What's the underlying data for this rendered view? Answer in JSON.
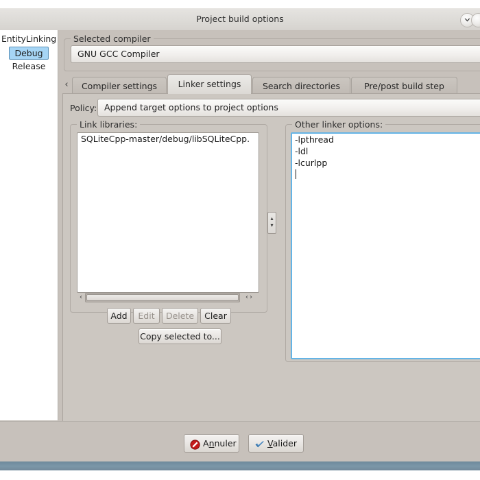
{
  "window": {
    "title": "Project build options",
    "collapse_icon": "chevron-down-icon"
  },
  "sidebar": {
    "items": [
      {
        "label": "EntityLinking",
        "selected": false,
        "level": 0
      },
      {
        "label": "Debug",
        "selected": true,
        "level": 1
      },
      {
        "label": "Release",
        "selected": false,
        "level": 1
      }
    ]
  },
  "compiler_group": {
    "title": "Selected compiler",
    "selected_value": "GNU GCC Compiler"
  },
  "tabs": {
    "scroll_left_icon": "chevron-left-icon",
    "items": [
      {
        "label": "Compiler settings",
        "active": false
      },
      {
        "label": "Linker settings",
        "active": true
      },
      {
        "label": "Search directories",
        "active": false
      },
      {
        "label": "Pre/post build step",
        "active": false
      }
    ]
  },
  "policy": {
    "label": "Policy:",
    "value": "Append target options to project options"
  },
  "link_libraries": {
    "title": "Link libraries:",
    "items": [
      "SQLiteCpp-master/debug/libSQLiteCpp."
    ],
    "scrollbar": {
      "left_arrow_icon": "chevron-left-icon",
      "right_arrows_icon": "chevron-left-right-icon"
    },
    "buttons": [
      {
        "label": "Add",
        "enabled": true
      },
      {
        "label": "Edit",
        "enabled": false
      },
      {
        "label": "Delete",
        "enabled": false
      },
      {
        "label": "Clear",
        "enabled": true
      }
    ],
    "copy_button": {
      "label": "Copy selected to...",
      "enabled": true
    }
  },
  "other_linker_options": {
    "title": "Other linker options:",
    "lines": [
      "-lpthread",
      "-ldl",
      "-lcurlpp"
    ],
    "caret_line": 3,
    "focus_color": "#64b4e6"
  },
  "splitter": {
    "icon": "vertical-resize-icon",
    "glyph_up": "▴",
    "glyph_down": "▾"
  },
  "dialog_buttons": {
    "cancel": {
      "label_before": "A",
      "label_mnemonic": "n",
      "label_after": "nuler",
      "icon": "cancel-icon"
    },
    "ok": {
      "label_before": "",
      "label_mnemonic": "V",
      "label_after": "alider",
      "icon": "check-icon"
    }
  },
  "colors": {
    "dialog_bg": "#c7c1bb",
    "selection_blue": "#a6d5f5",
    "focus_blue": "#64b4e6",
    "taskbar_blue": "#7b97a8"
  }
}
